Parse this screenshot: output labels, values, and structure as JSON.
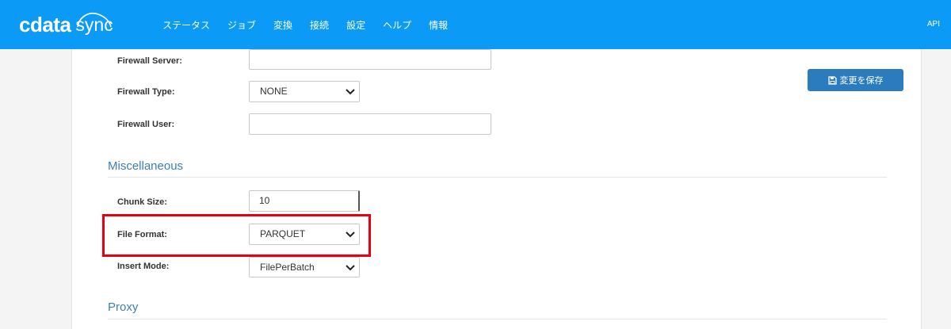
{
  "header": {
    "logo_brand": "cdata",
    "logo_product": "sync",
    "nav": [
      "ステータス",
      "ジョブ",
      "変換",
      "接続",
      "設定",
      "ヘルプ",
      "情報"
    ],
    "api_label": "API"
  },
  "toolbar": {
    "save_label": "変更を保存"
  },
  "firewall": {
    "server_label": "Firewall Server:",
    "server_value": "",
    "type_label": "Firewall Type:",
    "type_value": "NONE",
    "user_label": "Firewall User:",
    "user_value": ""
  },
  "misc": {
    "title": "Miscellaneous",
    "chunk_size_label": "Chunk Size:",
    "chunk_size_value": "10",
    "file_format_label": "File Format:",
    "file_format_value": "PARQUET",
    "insert_mode_label": "Insert Mode:",
    "insert_mode_value": "FilePerBatch"
  },
  "proxy": {
    "title": "Proxy"
  },
  "colors": {
    "topbar": "#0b9af5",
    "section_title": "#3d7fb8",
    "save_button": "#2b7bbf",
    "highlight": "#e60012"
  }
}
